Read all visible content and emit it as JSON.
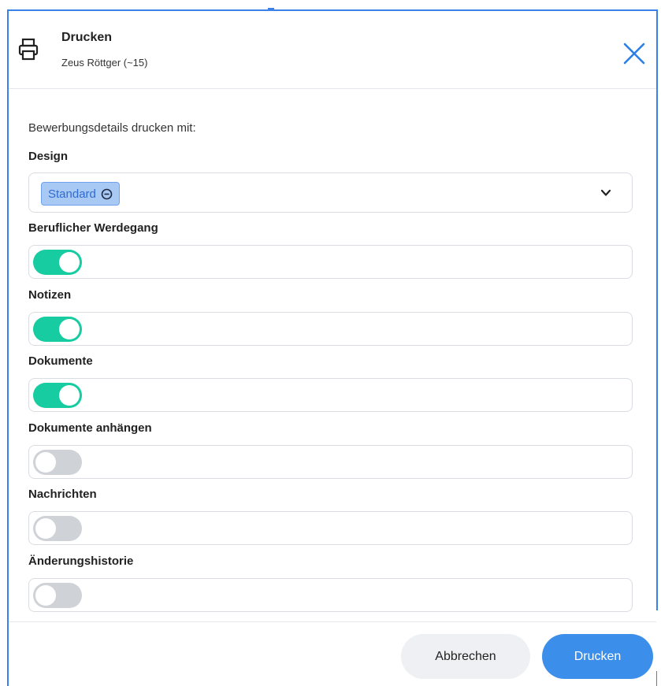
{
  "header": {
    "title": "Drucken",
    "subtitle": "Zeus Röttger (~15)"
  },
  "body": {
    "intro": "Bewerbungsdetails drucken mit:",
    "design": {
      "label": "Design",
      "selected": "Standard"
    },
    "toggles": [
      {
        "label": "Beruflicher Werdegang",
        "on": true
      },
      {
        "label": "Notizen",
        "on": true
      },
      {
        "label": "Dokumente",
        "on": true
      },
      {
        "label": "Dokumente anhängen",
        "on": false
      },
      {
        "label": "Nachrichten",
        "on": false
      },
      {
        "label": "Änderungshistorie",
        "on": false
      }
    ]
  },
  "footer": {
    "cancel_label": "Abbrechen",
    "print_label": "Drucken"
  },
  "colors": {
    "accent": "#3b8eea",
    "toggle_on": "#16cca0",
    "toggle_off": "#cfd3d7",
    "chip_bg": "#a9c9f5"
  }
}
